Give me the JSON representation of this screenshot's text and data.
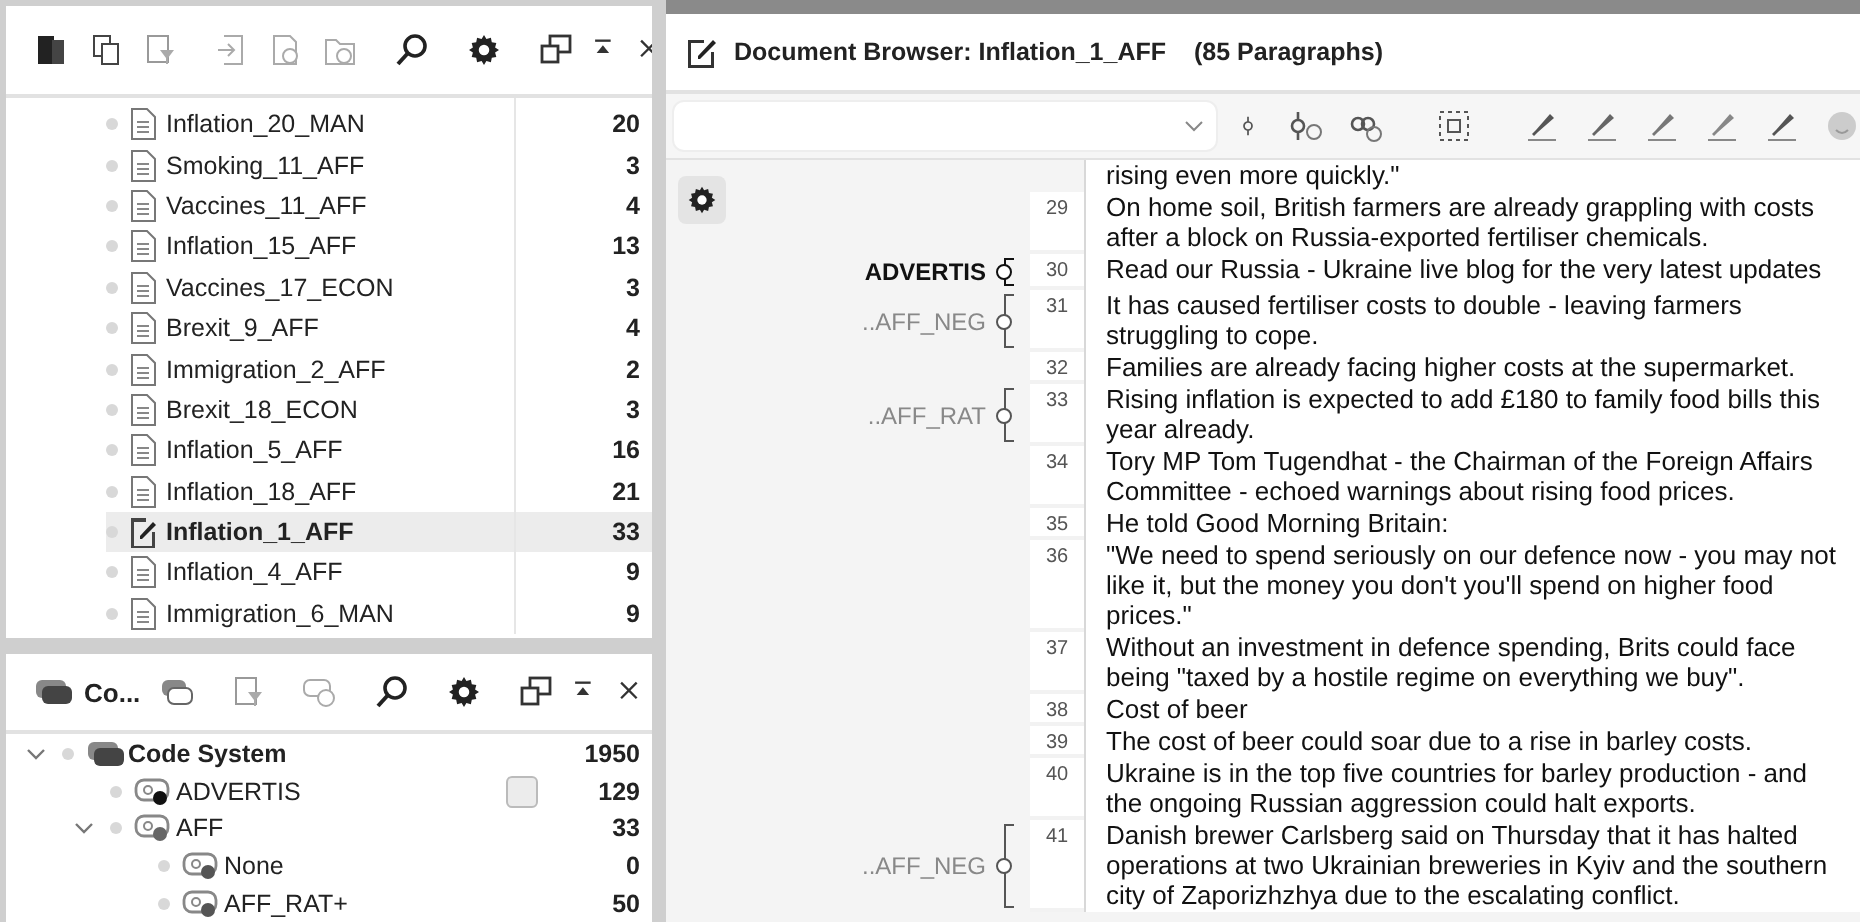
{
  "documents_panel": {
    "rows": [
      {
        "name": "Inflation_20_MAN",
        "count": "20",
        "selected": false,
        "kind": "document"
      },
      {
        "name": "Smoking_11_AFF",
        "count": "3",
        "selected": false,
        "kind": "document"
      },
      {
        "name": "Vaccines_11_AFF",
        "count": "4",
        "selected": false,
        "kind": "document"
      },
      {
        "name": "Inflation_15_AFF",
        "count": "13",
        "selected": false,
        "kind": "document"
      },
      {
        "name": "Vaccines_17_ECON",
        "count": "3",
        "selected": false,
        "kind": "document"
      },
      {
        "name": "Brexit_9_AFF",
        "count": "4",
        "selected": false,
        "kind": "document"
      },
      {
        "name": "Immigration_2_AFF",
        "count": "2",
        "selected": false,
        "kind": "document"
      },
      {
        "name": "Brexit_18_ECON",
        "count": "3",
        "selected": false,
        "kind": "document"
      },
      {
        "name": "Inflation_5_AFF",
        "count": "16",
        "selected": false,
        "kind": "document"
      },
      {
        "name": "Inflation_18_AFF",
        "count": "21",
        "selected": false,
        "kind": "document"
      },
      {
        "name": "Inflation_1_AFF",
        "count": "33",
        "selected": true,
        "kind": "edited"
      },
      {
        "name": "Inflation_4_AFF",
        "count": "9",
        "selected": false,
        "kind": "document"
      },
      {
        "name": "Immigration_6_MAN",
        "count": "9",
        "selected": false,
        "kind": "document"
      }
    ]
  },
  "codes_panel": {
    "title": "Co...",
    "tree": [
      {
        "name": "Code System",
        "count": "1950",
        "kind": "root",
        "expanded": true,
        "children": [
          {
            "name": "ADVERTIS",
            "count": "129",
            "kind": "code",
            "color": "#111111",
            "marked": true
          },
          {
            "name": "AFF",
            "count": "33",
            "kind": "code",
            "color": "#666666",
            "marked": false,
            "expanded": true,
            "children": [
              {
                "name": "None",
                "count": "0",
                "kind": "code",
                "color": "#555555",
                "marked": false
              },
              {
                "name": "AFF_RAT+",
                "count": "50",
                "kind": "code",
                "color": "#555555",
                "marked": false
              }
            ]
          }
        ]
      }
    ]
  },
  "document_browser": {
    "title": "Document Browser: Inflation_1_AFF",
    "paragraph_count": "(85 Paragraphs)",
    "paragraphs": [
      {
        "text": "rising even more quickly.\""
      },
      {
        "number": "29",
        "text": "On home soil, British farmers are already grappling with costs after a block on Russia-exported fertiliser chemicals."
      },
      {
        "number": "30",
        "text": "Read our Russia - Ukraine live blog for the very latest updates",
        "code": {
          "label": "ADVERTIS",
          "active": true
        }
      },
      {
        "number": "31",
        "text": "It has caused fertiliser costs to double - leaving farmers struggling to cope.",
        "code": {
          "label": "..AFF_NEG",
          "active": false
        }
      },
      {
        "number": "32",
        "text": "Families are already facing higher costs at the supermarket."
      },
      {
        "number": "33",
        "text": "Rising inflation is expected to add £180 to family food bills this year already.",
        "code": {
          "label": "..AFF_RAT",
          "active": false
        }
      },
      {
        "number": "34",
        "text": "Tory MP Tom Tugendhat - the Chairman of the Foreign Affairs Committee - echoed warnings about rising food prices."
      },
      {
        "number": "35",
        "text": "He told Good Morning Britain:"
      },
      {
        "number": "36",
        "text": "\"We need to spend seriously on our defence now - you may not like it, but the money you don't you'll spend on higher food prices.\""
      },
      {
        "number": "37",
        "text": "Without an investment in defence spending, Brits could face being \"taxed by a hostile regime on everything we buy\"."
      },
      {
        "number": "38",
        "text": "Cost of beer"
      },
      {
        "number": "39",
        "text": "The cost of beer could soar due to a rise in barley costs."
      },
      {
        "number": "40",
        "text": "Ukraine is in the top five countries for barley production - and the ongoing Russian aggression could halt exports."
      },
      {
        "number": "41",
        "text": "Danish brewer Carlsberg said on Thursday that it has halted operations at two Ukrainian breweries in Kyiv and the southern city of Zaporizhzhya due to the escalating conflict.",
        "code": {
          "label": "..AFF_NEG",
          "active": false
        }
      }
    ]
  }
}
